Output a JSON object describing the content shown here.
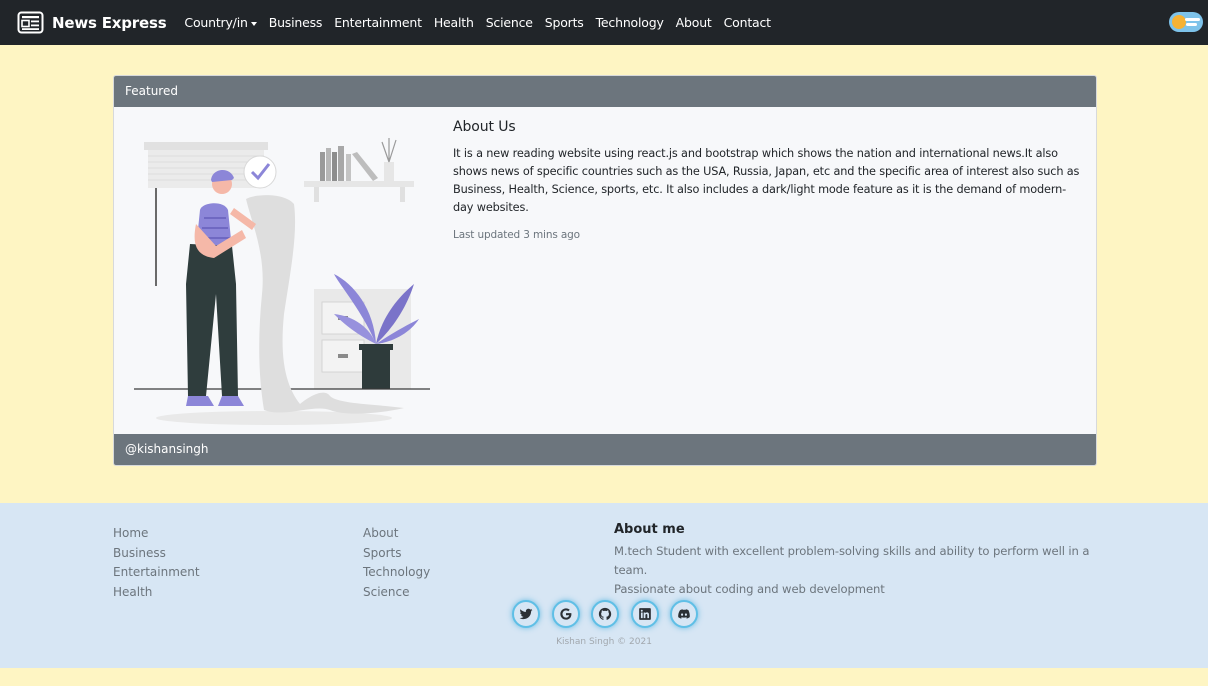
{
  "navbar": {
    "brand": "News Express",
    "brand_icon": "newspaper-icon",
    "links": [
      "Country/in",
      "Business",
      "Entertainment",
      "Health",
      "Science",
      "Sports",
      "Technology",
      "About",
      "Contact"
    ],
    "mode_toggle_icon": "day-night-toggle-icon"
  },
  "card": {
    "header": "Featured",
    "title": "About Us",
    "text": "It is a new reading website using react.js and bootstrap which shows the nation and international news.It also shows news of specific countries such as the USA, Russia, Japan, etc and the specific area of interest also such as Business, Health, Science, sports, etc. It also includes a dark/light mode feature as it is the demand of modern-day websites.",
    "meta": "Last updated 3 mins ago",
    "footer": "@kishansingh"
  },
  "footer": {
    "col1": [
      "Home",
      "Business",
      "Entertainment",
      "Health"
    ],
    "col2": [
      "About",
      "Sports",
      "Technology",
      "Science"
    ],
    "about_title": "About me",
    "about_line1": "M.tech Student with excellent problem-solving skills and ability to perform well in a team.",
    "about_line2": "Passionate about coding and web development",
    "socials": [
      "twitter-icon",
      "google-icon",
      "github-icon",
      "linkedin-icon",
      "discord-icon"
    ],
    "copyright": "Kishan Singh © 2021"
  },
  "colors": {
    "page_bg": "#fef5c3",
    "navbar_bg": "#212529",
    "card_header_bg": "#6c757d",
    "footer_bg": "#d7e6f4",
    "accent": "#8c86d8"
  }
}
